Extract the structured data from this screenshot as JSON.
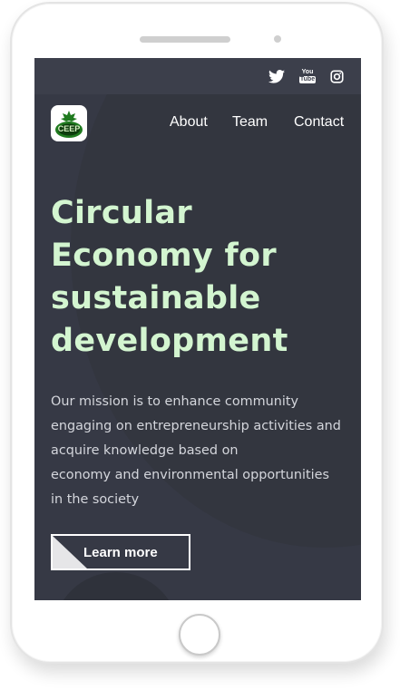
{
  "social": {
    "icons": [
      "twitter-icon",
      "youtube-icon",
      "instagram-icon"
    ],
    "youtube_top": "You",
    "youtube_bottom": "Tube"
  },
  "nav": {
    "logo_text": "CEEP",
    "links": [
      "About",
      "Team",
      "Contact"
    ]
  },
  "hero": {
    "title_lines": [
      "Circular",
      "Economy for",
      "sustainable",
      "development"
    ],
    "mission_lines": [
      "Our mission is to enhance community",
      "engaging on entrepreneurship activities and",
      "acquire knowledge based on",
      "economy and environmental opportunities",
      "in the society"
    ],
    "cta_label": "Learn more"
  },
  "colors": {
    "screen_bg": "#363945",
    "topbar_bg": "#3c3f4b",
    "title_color": "#d3f5d0",
    "logo_green": "#1f7a1f"
  }
}
